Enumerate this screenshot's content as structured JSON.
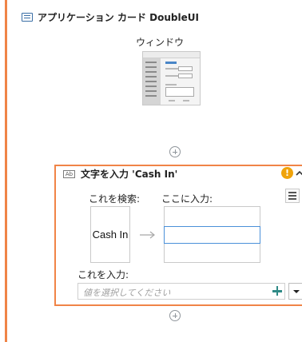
{
  "app_card": {
    "title": "アプリケーション カード DoubleUI",
    "window_label": "ウィンドウ"
  },
  "type_into": {
    "title": "文字を入力 'Cash In'",
    "search_label": "これを検索:",
    "search_target": "Cash In",
    "input_here_label": "ここに入力:",
    "text_label": "これを入力:",
    "value_placeholder": "値を選択してください"
  },
  "colors": {
    "accent_orange": "#f08447",
    "warning": "#f0a30a",
    "add_plus": "#2f8a86",
    "focus_blue": "#4a90d9"
  },
  "icons": [
    "app-window-icon",
    "add-activity-icon",
    "type-into-icon",
    "warning-icon",
    "collapse-icon",
    "menu-icon",
    "arrow-right-icon",
    "plus-icon",
    "dropdown-arrow-icon"
  ]
}
